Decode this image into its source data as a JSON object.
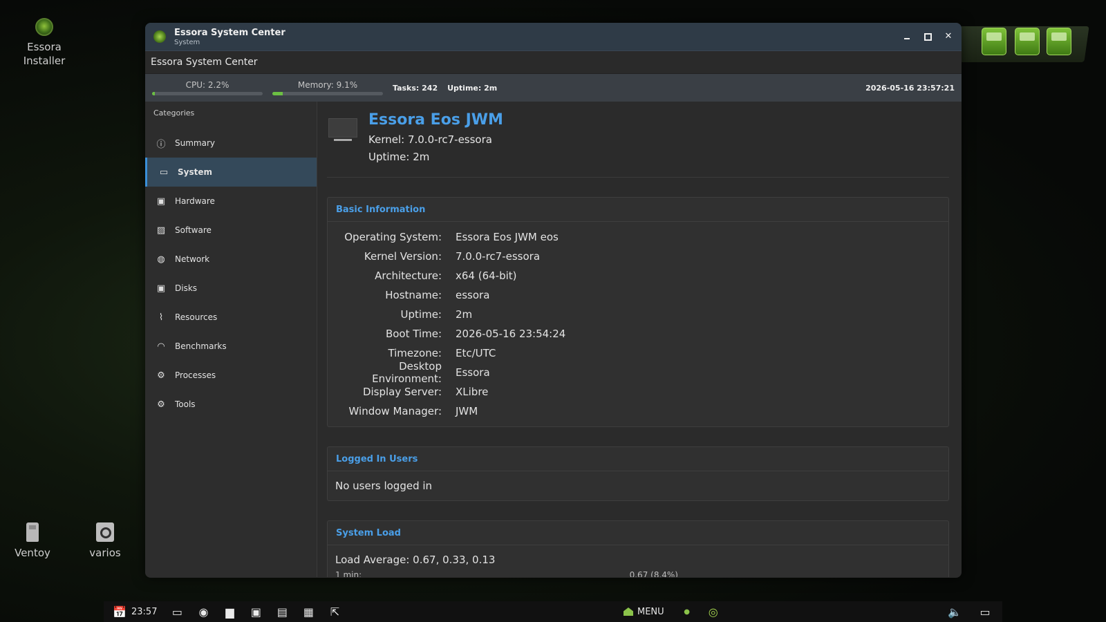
{
  "desktop": {
    "icons": [
      {
        "label": "Essora\nInstaller"
      },
      {
        "label": "Ventoy"
      },
      {
        "label": "varios"
      }
    ],
    "installer_line1": "Essora",
    "installer_line2": "Installer"
  },
  "window": {
    "title": "Essora System Center",
    "subtitle": "System",
    "header_title": "Essora System Center"
  },
  "status": {
    "cpu_label": "CPU: 2.2%",
    "cpu_fraction": 0.022,
    "memory_label": "Memory: 9.1%",
    "memory_fraction": 0.091,
    "tasks": "Tasks: 242",
    "uptime": "Uptime: 2m",
    "clock": "2026-05-16 23:57:21"
  },
  "sidebar": {
    "heading": "Categories",
    "items": [
      {
        "label": "Summary",
        "icon": "info-icon",
        "glyph": "ⓘ"
      },
      {
        "label": "System",
        "icon": "monitor-icon",
        "glyph": "▭"
      },
      {
        "label": "Hardware",
        "icon": "hardware-icon",
        "glyph": "▣"
      },
      {
        "label": "Software",
        "icon": "software-icon",
        "glyph": "▨"
      },
      {
        "label": "Network",
        "icon": "globe-icon",
        "glyph": "◍"
      },
      {
        "label": "Disks",
        "icon": "disk-icon",
        "glyph": "▣"
      },
      {
        "label": "Resources",
        "icon": "activity-icon",
        "glyph": "⌇"
      },
      {
        "label": "Benchmarks",
        "icon": "gauge-icon",
        "glyph": "◠"
      },
      {
        "label": "Processes",
        "icon": "processes-icon",
        "glyph": "⚙"
      },
      {
        "label": "Tools",
        "icon": "gear-icon",
        "glyph": "⚙"
      }
    ],
    "active_index": 1
  },
  "system": {
    "name": "Essora Eos JWM",
    "kernel": "Kernel: 7.0.0-rc7-essora",
    "uptime": "Uptime: 2m"
  },
  "basic_info": {
    "title": "Basic Information",
    "rows": [
      {
        "label": "Operating System:",
        "value": "Essora Eos JWM eos"
      },
      {
        "label": "Kernel Version:",
        "value": "7.0.0-rc7-essora"
      },
      {
        "label": "Architecture:",
        "value": "x64 (64-bit)"
      },
      {
        "label": "Hostname:",
        "value": "essora"
      },
      {
        "label": "Uptime:",
        "value": "2m"
      },
      {
        "label": "Boot Time:",
        "value": "2026-05-16 23:54:24"
      },
      {
        "label": "Timezone:",
        "value": "Etc/UTC"
      },
      {
        "label": "Desktop Environment:",
        "value": "Essora"
      },
      {
        "label": "Display Server:",
        "value": "XLibre"
      },
      {
        "label": "Window Manager:",
        "value": "JWM"
      }
    ]
  },
  "logged_users": {
    "title": "Logged In Users",
    "message": "No users logged in"
  },
  "system_load": {
    "title": "System Load",
    "load_average": "Load Average: 0.67, 0.33, 0.13",
    "row_label": "1 min:",
    "row_value": "0.67 (8.4%)"
  },
  "taskbar": {
    "time": "23:57",
    "menu_label": "MENU"
  },
  "colors": {
    "accent": "#4a9fe8",
    "meter": "#6cc043",
    "active_item": "#34495a"
  }
}
